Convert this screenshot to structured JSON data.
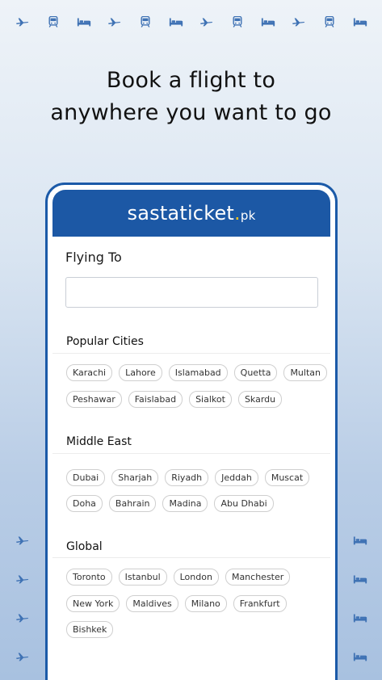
{
  "headline": {
    "line1": "Book a flight to",
    "line2": "anywhere you want to go"
  },
  "brand": {
    "name": "sastaticket",
    "dot": ".",
    "tld": "pk",
    "header_color": "#1c58a5",
    "dot_color": "#f5c31c"
  },
  "search": {
    "label": "Flying To",
    "value": "",
    "placeholder": ""
  },
  "sections": [
    {
      "title": "Popular Cities",
      "rows": [
        [
          "Karachi",
          "Lahore",
          "Islamabad",
          "Quetta",
          "Multan"
        ],
        [
          "Peshawar",
          "Faislabad",
          "Sialkot",
          "Skardu"
        ]
      ]
    },
    {
      "title": "Middle East",
      "rows": [
        [
          "Dubai",
          "Sharjah",
          "Riyadh",
          "Jeddah",
          "Muscat"
        ],
        [
          "Doha",
          "Bahrain",
          "Madina",
          "Abu Dhabi"
        ]
      ]
    },
    {
      "title": "Global",
      "rows": [
        [
          "Toronto",
          "Istanbul",
          "London",
          "Manchester"
        ],
        [
          "New York",
          "Maldives",
          "Milano",
          "Frankfurt"
        ],
        [
          "Bishkek"
        ]
      ]
    }
  ],
  "decor_icons": [
    "plane-icon",
    "train-icon",
    "bed-icon"
  ]
}
